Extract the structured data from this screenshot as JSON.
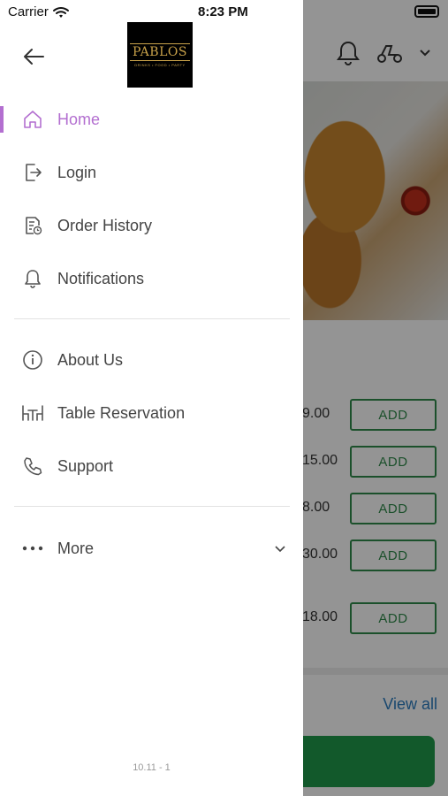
{
  "status_bar": {
    "carrier": "Carrier",
    "time": "8:23 PM"
  },
  "drawer": {
    "logo_text": "PABLOS",
    "logo_subtext": "DRINKS • FOOD • PARTY",
    "menu_primary": [
      {
        "label": "Home",
        "icon": "home-icon",
        "active": true
      },
      {
        "label": "Login",
        "icon": "login-icon"
      },
      {
        "label": "Order History",
        "icon": "order-history-icon"
      },
      {
        "label": "Notifications",
        "icon": "bell-icon"
      }
    ],
    "menu_secondary": [
      {
        "label": "About Us",
        "icon": "info-icon"
      },
      {
        "label": "Table Reservation",
        "icon": "table-icon"
      },
      {
        "label": "Support",
        "icon": "phone-icon"
      }
    ],
    "more": {
      "label": "More",
      "icon": "more-dots-icon"
    },
    "version": "10.11 - 1"
  },
  "background": {
    "items": [
      {
        "price": "9.00",
        "action": "ADD"
      },
      {
        "price": "15.00",
        "action": "ADD"
      },
      {
        "price": "8.00",
        "action": "ADD"
      },
      {
        "price": "30.00",
        "action": "ADD"
      },
      {
        "price": "18.00",
        "action": "ADD"
      }
    ],
    "view_all": "View all"
  },
  "colors": {
    "accent": "#b36fd0",
    "add_green": "#2f8a4a",
    "link_blue": "#2c7cbf",
    "cta_green": "#1f9a4b"
  }
}
